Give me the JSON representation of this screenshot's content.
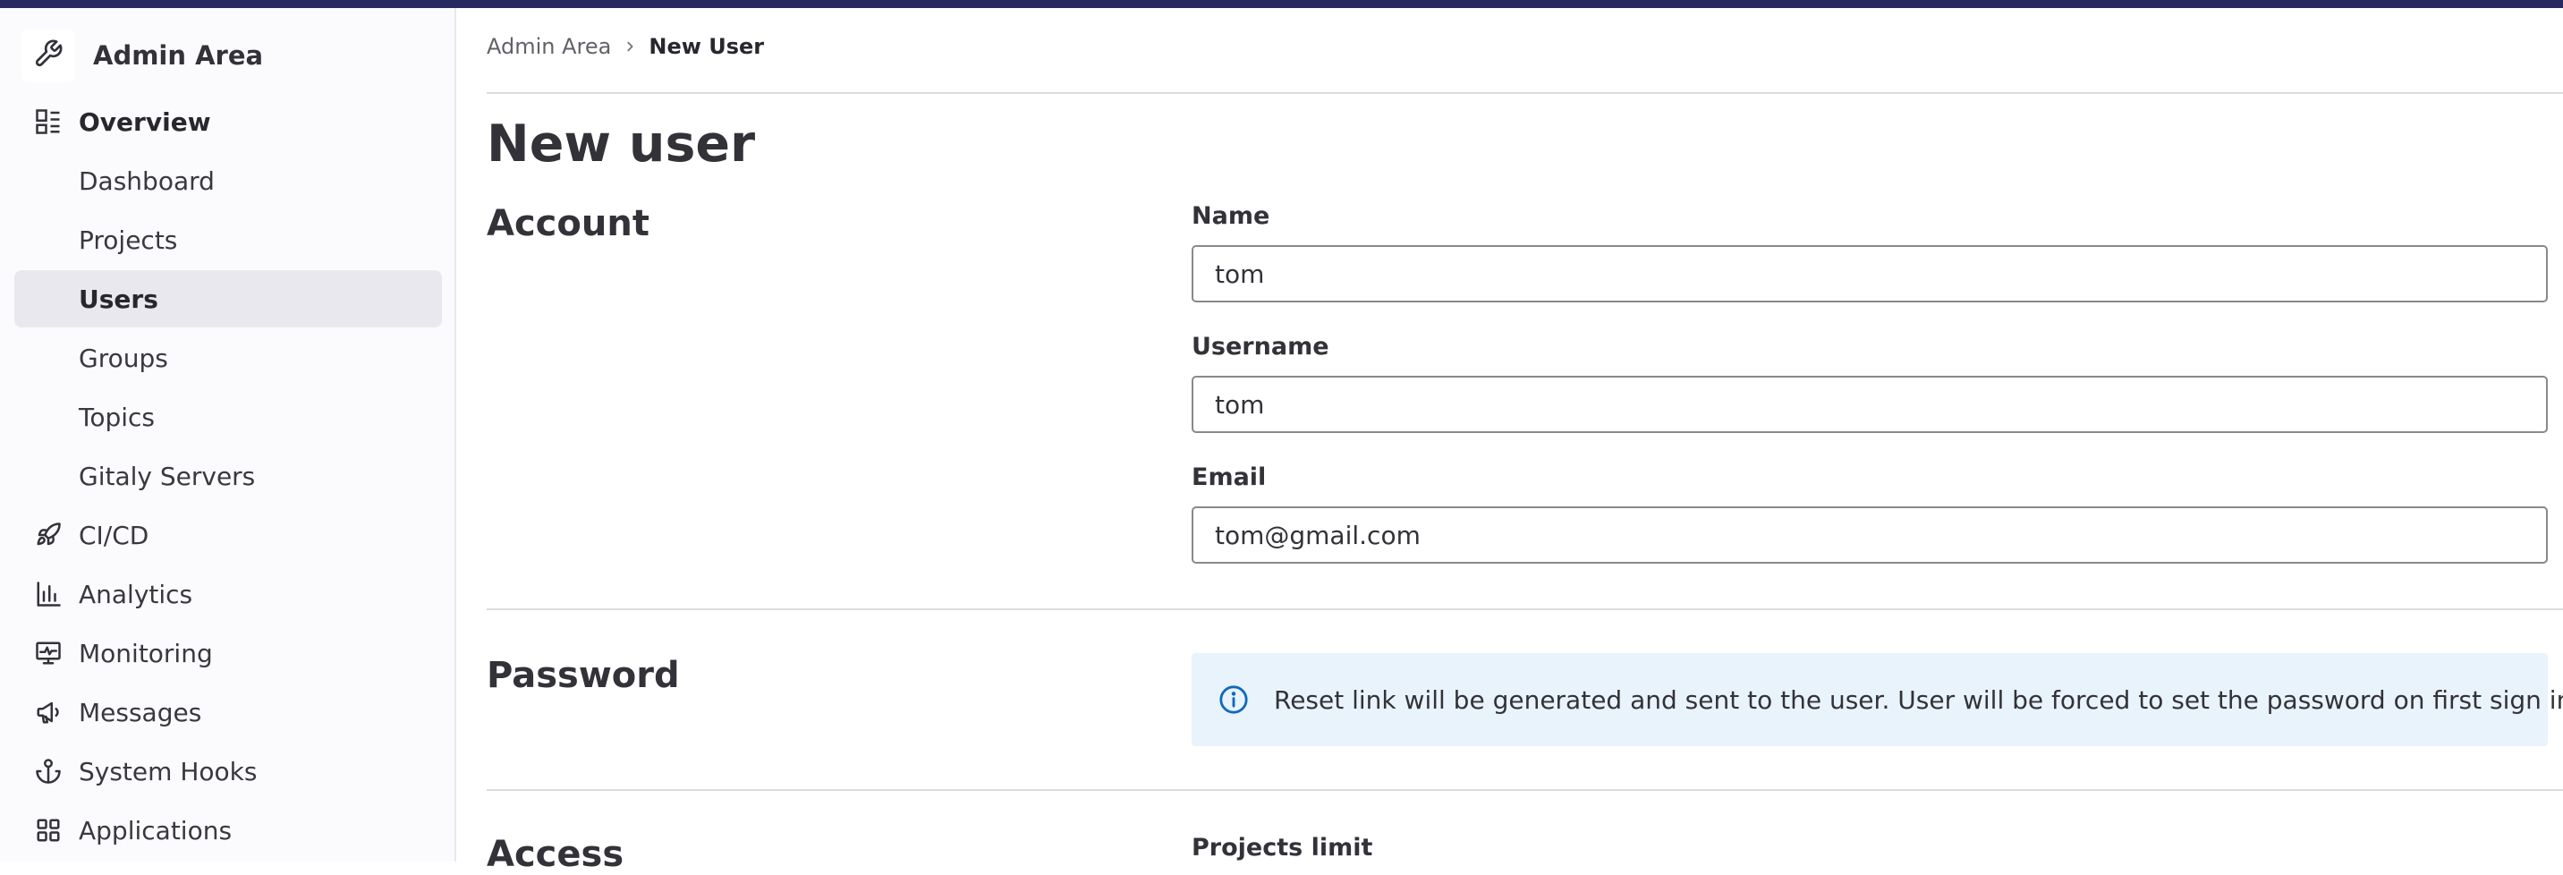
{
  "sidebar": {
    "title": "Admin Area",
    "items": [
      {
        "label": "Overview",
        "icon": "overview-icon"
      },
      {
        "label": "Dashboard"
      },
      {
        "label": "Projects"
      },
      {
        "label": "Users",
        "active": true
      },
      {
        "label": "Groups"
      },
      {
        "label": "Topics"
      },
      {
        "label": "Gitaly Servers"
      },
      {
        "label": "CI/CD",
        "icon": "rocket-icon"
      },
      {
        "label": "Analytics",
        "icon": "chart-icon"
      },
      {
        "label": "Monitoring",
        "icon": "monitor-icon"
      },
      {
        "label": "Messages",
        "icon": "bullhorn-icon"
      },
      {
        "label": "System Hooks",
        "icon": "anchor-icon"
      },
      {
        "label": "Applications",
        "icon": "applications-icon"
      }
    ]
  },
  "breadcrumb": {
    "items": [
      {
        "label": "Admin Area"
      },
      {
        "label": "New User"
      }
    ]
  },
  "page": {
    "title": "New user"
  },
  "account": {
    "title": "Account",
    "name": {
      "label": "Name",
      "value": "tom"
    },
    "username": {
      "label": "Username",
      "value": "tom"
    },
    "email": {
      "label": "Email",
      "value": "tom@gmail.com"
    }
  },
  "password": {
    "title": "Password",
    "alert": "Reset link will be generated and sent to the user. User will be forced to set the password on first sign in."
  },
  "access": {
    "title": "Access",
    "projects_limit_label": "Projects limit"
  },
  "colors": {
    "topbar": "#292961",
    "active_item": "#e9e8ee",
    "info_bg": "#e9f3fc",
    "info_icon": "#1068bf"
  }
}
